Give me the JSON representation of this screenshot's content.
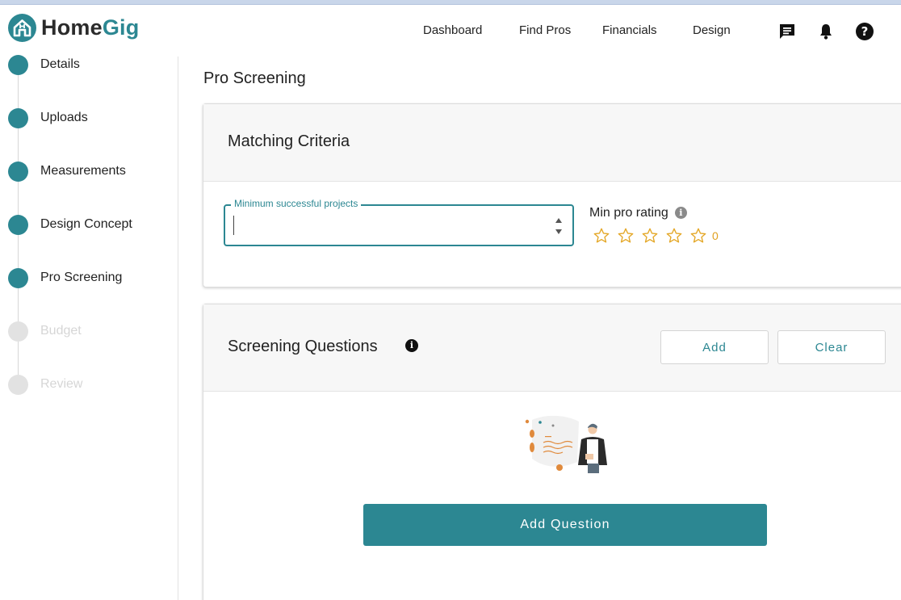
{
  "app": {
    "logo_home": "Home",
    "logo_gig": "Gig",
    "accent_color": "#2c8792"
  },
  "nav": {
    "items": [
      "Dashboard",
      "Find Pros",
      "Financials",
      "Design"
    ],
    "icons": [
      "chat-icon",
      "bell-icon",
      "help-icon"
    ]
  },
  "sidebar": {
    "steps": [
      {
        "label": "Details",
        "status": "complete"
      },
      {
        "label": "Uploads",
        "status": "complete"
      },
      {
        "label": "Measurements",
        "status": "complete"
      },
      {
        "label": "Design Concept",
        "status": "complete"
      },
      {
        "label": "Pro Screening",
        "status": "current"
      },
      {
        "label": "Budget",
        "status": "inactive"
      },
      {
        "label": "Review",
        "status": "inactive"
      }
    ]
  },
  "main": {
    "page_title": "Pro Screening",
    "matching": {
      "title": "Matching Criteria",
      "min_projects_label": "Minimum successful projects",
      "min_projects_value": "",
      "min_rating_label": "Min pro rating",
      "min_rating_value": "0",
      "rating_stars_total": 5,
      "rating_stars_filled": 0
    },
    "screening": {
      "title": "Screening Questions",
      "add_label": "Add",
      "clear_label": "Clear",
      "add_question_label": "Add Question"
    }
  }
}
